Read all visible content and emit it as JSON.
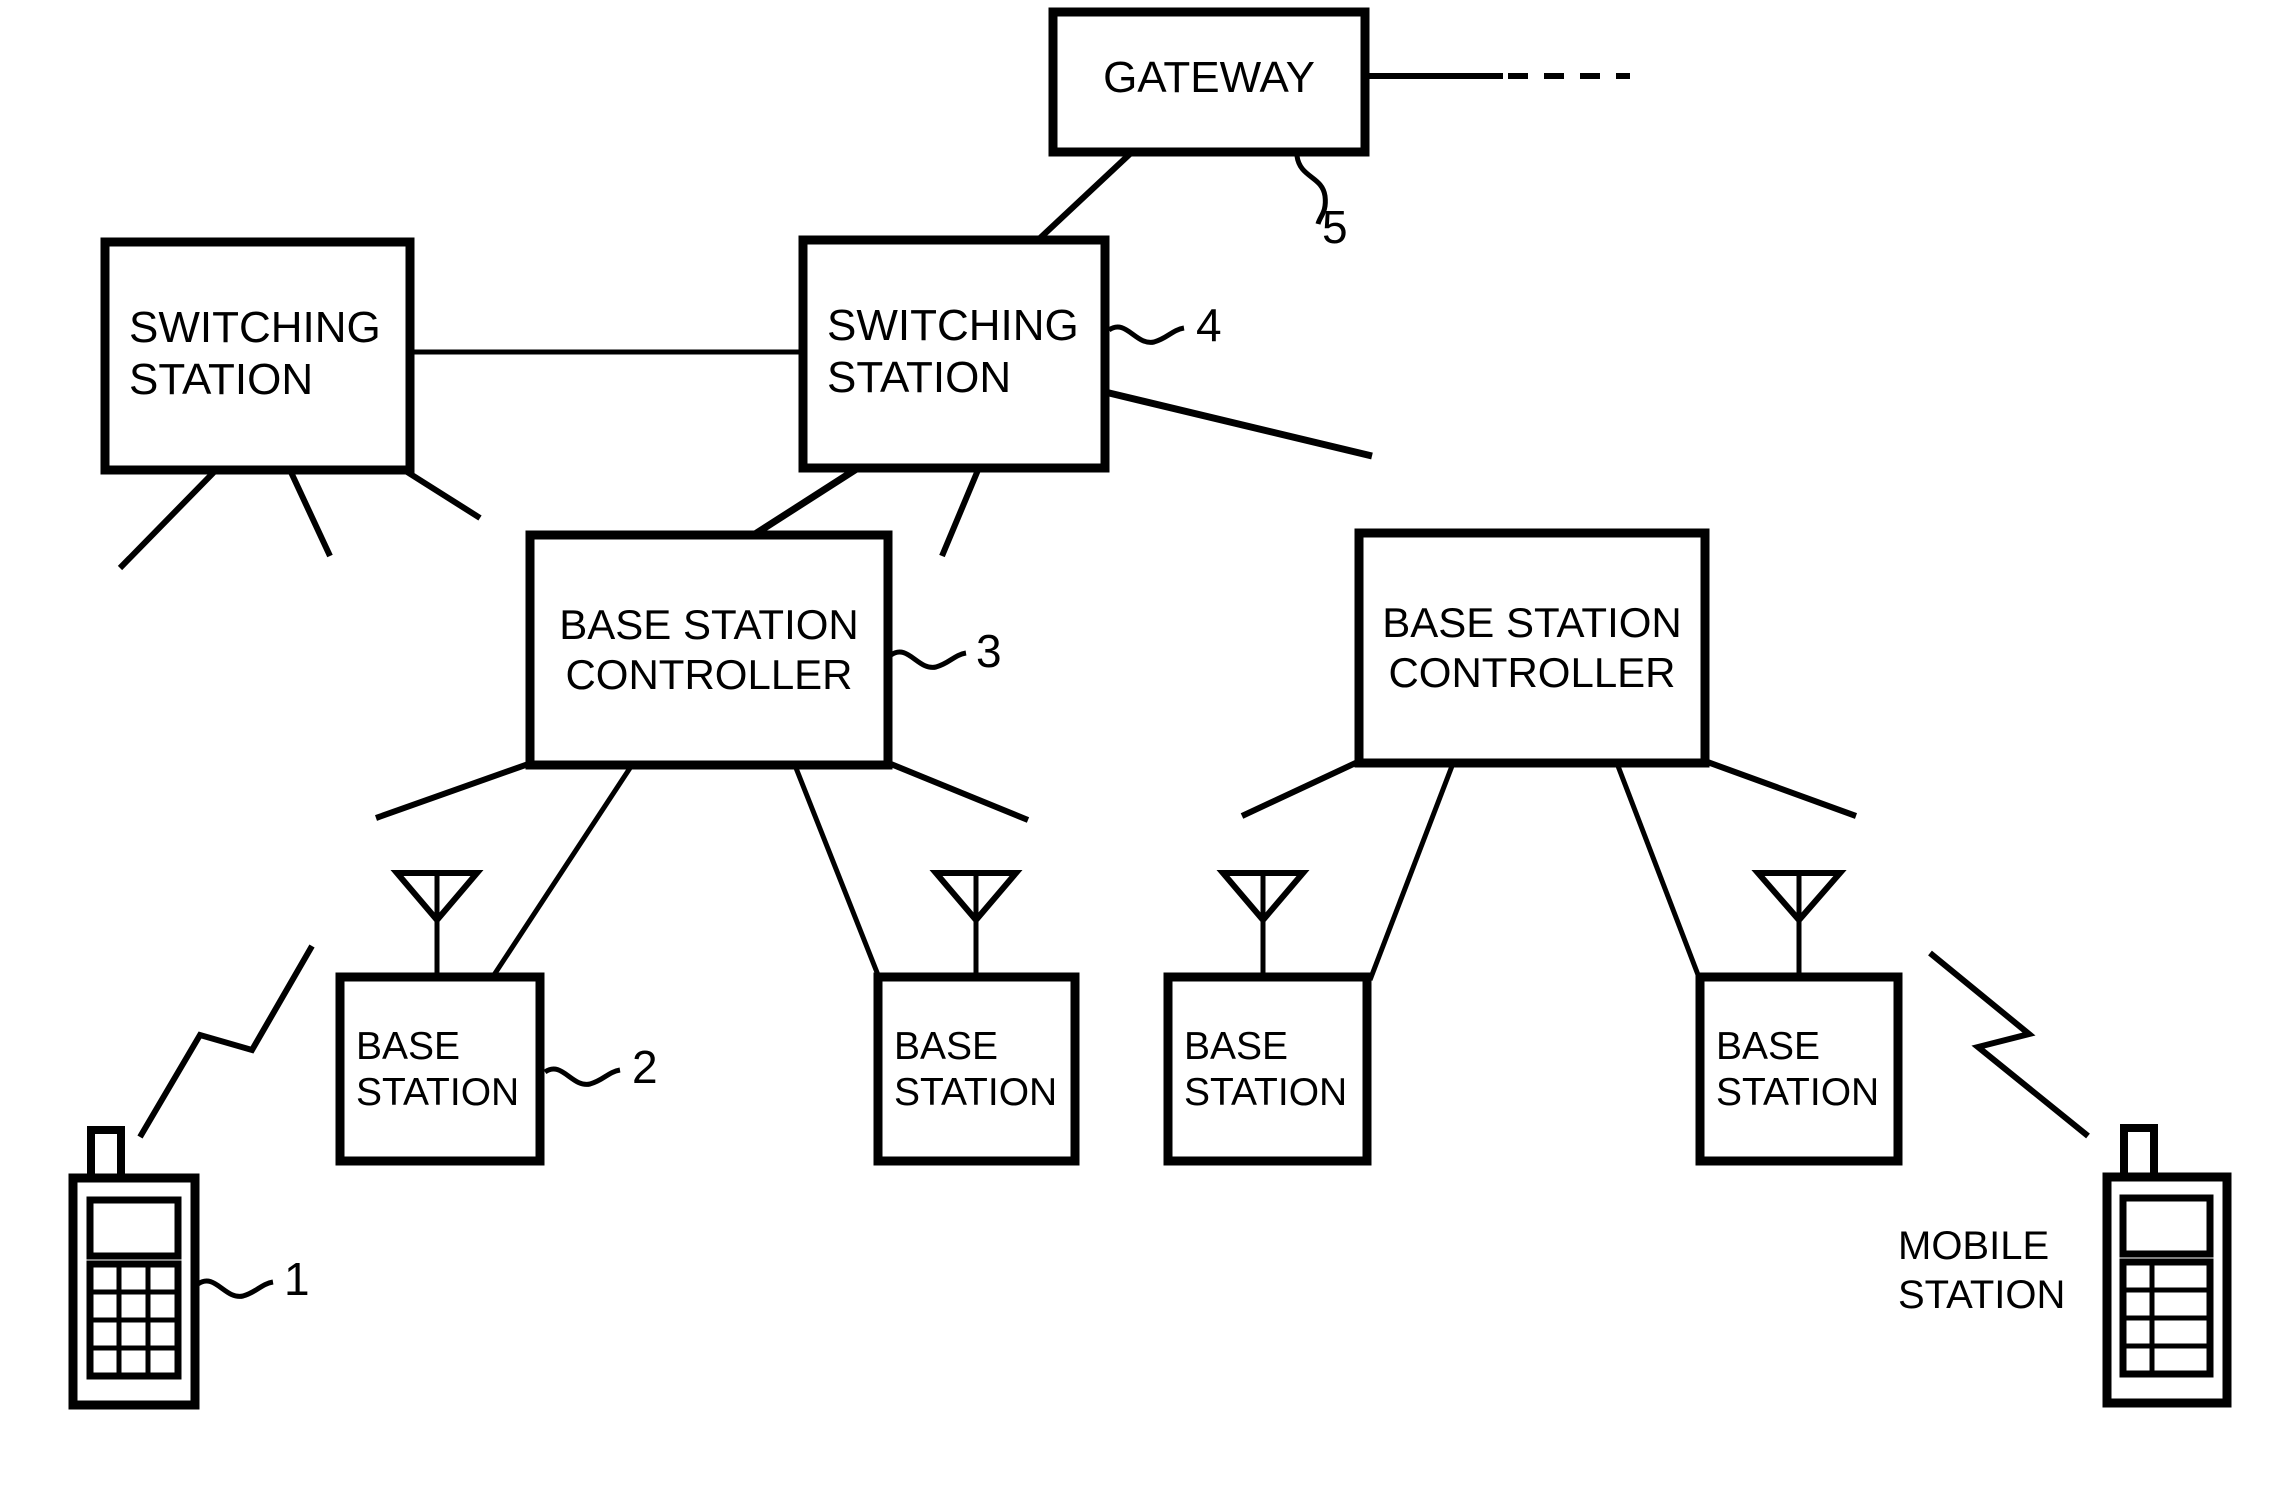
{
  "figure": {
    "kind": "patent-network-diagram",
    "line_color": "#000000",
    "background": "#ffffff"
  },
  "nodes": {
    "gateway": {
      "label": "GATEWAY",
      "ref": "5"
    },
    "switching_station_left": {
      "label": "SWITCHING\nSTATION",
      "ref": ""
    },
    "switching_station_right": {
      "label": "SWITCHING\nSTATION",
      "ref": "4"
    },
    "base_station_controller_left": {
      "label": "BASE STATION\nCONTROLLER",
      "ref": "3"
    },
    "base_station_controller_right": {
      "label": "BASE STATION\nCONTROLLER",
      "ref": ""
    },
    "base_station_1": {
      "label": "BASE\nSTATION",
      "ref": "2"
    },
    "base_station_2": {
      "label": "BASE\nSTATION",
      "ref": ""
    },
    "base_station_3": {
      "label": "BASE\nSTATION",
      "ref": ""
    },
    "base_station_4": {
      "label": "BASE\nSTATION",
      "ref": ""
    },
    "mobile_station_left": {
      "label": "",
      "ref": "1"
    },
    "mobile_station_right": {
      "label": "MOBILE\nSTATION",
      "ref": ""
    }
  },
  "ref_numerals": {
    "mobile_station": "1",
    "base_station": "2",
    "base_station_controller": "3",
    "switching_station": "4",
    "gateway": "5"
  },
  "callouts": [
    {
      "name": "mobile-station-callout",
      "text": "1"
    },
    {
      "name": "base-station-callout",
      "text": "2"
    },
    {
      "name": "base-station-controller-callout",
      "text": "3"
    },
    {
      "name": "switching-station-callout",
      "text": "4"
    },
    {
      "name": "gateway-callout",
      "text": "5"
    }
  ],
  "free_text": {
    "mobile_station_right_label": "MOBILE\nSTATION"
  },
  "icons": {
    "antenna": "antenna-icon",
    "handset": "mobile-handset-icon",
    "radio_link": "radio-link-zigzag-icon",
    "external_network": "dashed-external-link"
  }
}
